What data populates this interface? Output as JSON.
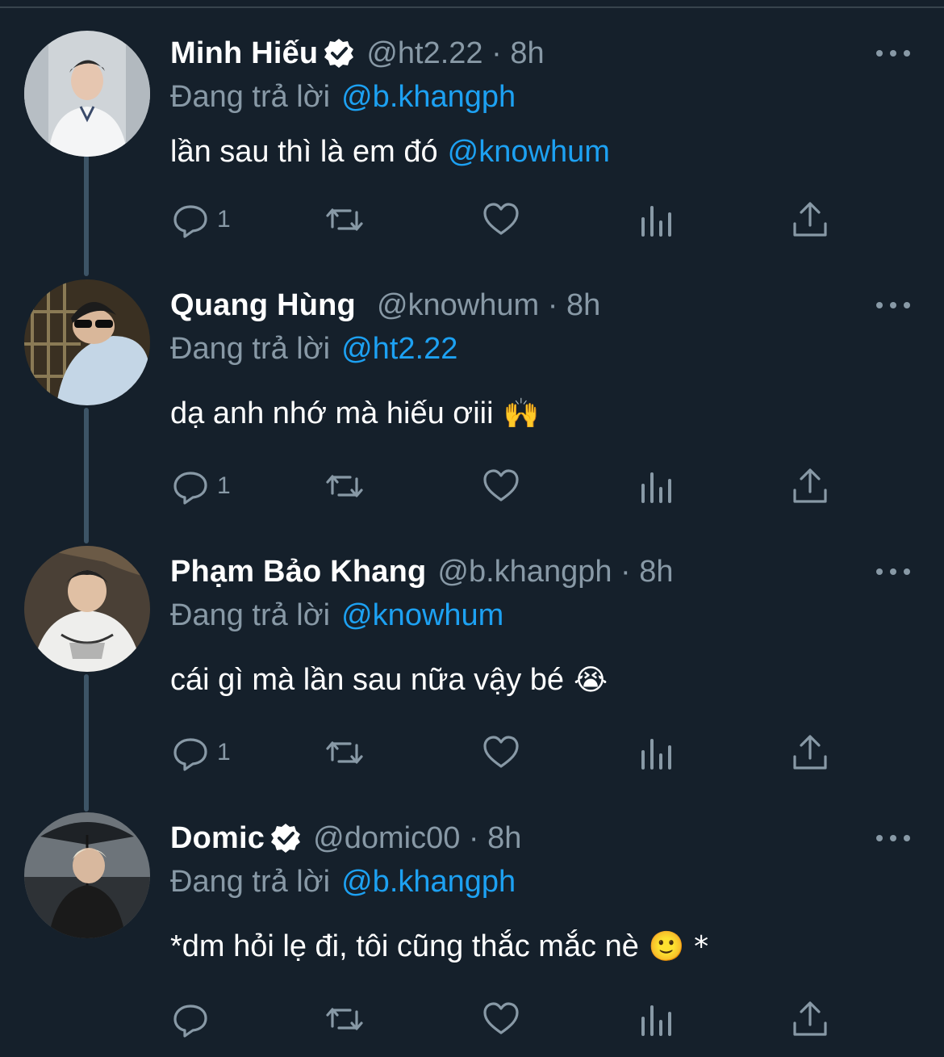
{
  "reply_prefix": "Đang trả lời",
  "tweets": [
    {
      "name": "Minh Hiếu",
      "verified": true,
      "handle_time": "@ht2.22 · 8h",
      "replying_to": "@b.khangph",
      "text": "lần sau thì là em đó",
      "text_mention": "@knowhum",
      "text_emoji": "",
      "reply_count": "1"
    },
    {
      "name": "Quang Hùng",
      "verified": false,
      "handle_time": "@knowhum · 8h",
      "replying_to": "@ht2.22",
      "text": "dạ anh nhớ mà hiếu ơiii",
      "text_mention": "",
      "text_emoji": "🙌",
      "reply_count": "1"
    },
    {
      "name": "Phạm Bảo Khang",
      "verified": false,
      "handle_time": "@b.khangph · 8h",
      "replying_to": "@knowhum",
      "text": "cái gì mà lần sau nữa vậy bé",
      "text_mention": "",
      "text_emoji": "😭",
      "reply_count": "1"
    },
    {
      "name": "Domic",
      "verified": true,
      "handle_time": "@domic00 · 8h",
      "replying_to": "@b.khangph",
      "text": "*dm hỏi lẹ đi, tôi cũng thắc mắc nè",
      "text_mention": "",
      "text_emoji": "🙂 *",
      "reply_count": ""
    }
  ],
  "colors": {
    "background": "#15202b",
    "secondary_text": "#8899a6",
    "link": "#1da1f2",
    "thread_line": "#3d5466"
  },
  "icons": [
    "reply-icon",
    "retweet-icon",
    "like-icon",
    "analytics-icon",
    "share-icon",
    "more-icon",
    "verified-badge-icon"
  ]
}
